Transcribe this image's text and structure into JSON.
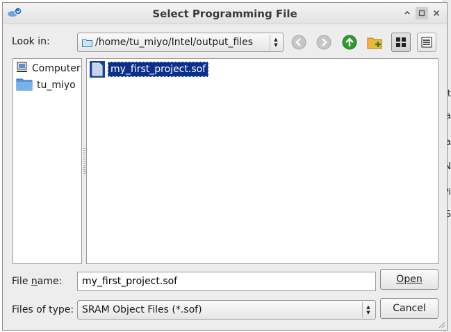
{
  "window": {
    "title": "Select Programming File"
  },
  "background_fragments": [
    "t",
    "a",
    "a",
    "N",
    "Pi",
    "S"
  ],
  "look_in": {
    "label": "Look in:",
    "path": "/home/tu_miyo/Intel/output_files"
  },
  "toolbar": {
    "icons": [
      "back-arrow-icon",
      "forward-arrow-icon",
      "up-folder-icon",
      "new-folder-icon",
      "list-view-icon",
      "detail-view-icon"
    ]
  },
  "sidebar": {
    "items": [
      {
        "label": "Computer",
        "icon": "computer-icon"
      },
      {
        "label": "tu_miyo",
        "icon": "folder-icon"
      }
    ]
  },
  "files": [
    {
      "name": "my_first_project.sof",
      "icon": "file-icon",
      "selected": true
    }
  ],
  "file_name": {
    "label": "File name:",
    "mnemonic": "n",
    "value": "my_first_project.sof"
  },
  "file_type": {
    "label": "Files of type:",
    "value": "SRAM Object Files (*.sof)"
  },
  "buttons": {
    "open": "Open",
    "cancel": "Cancel"
  },
  "colors": {
    "selection": "#0b2f8a",
    "arrow_green": "#2d9a2d",
    "folder_blue": "#4f97dc"
  }
}
